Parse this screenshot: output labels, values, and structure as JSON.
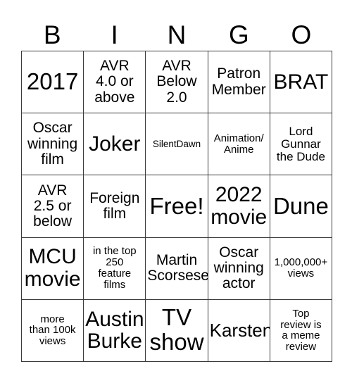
{
  "card": {
    "title": "BINGO",
    "header_letters": [
      "B",
      "I",
      "N",
      "G",
      "O"
    ],
    "grid_size": "5x5",
    "colors": {
      "background": "#ffffff",
      "border": "#3a3a3a",
      "text": "#000000"
    },
    "rows": [
      [
        {
          "text": "2017",
          "size": "xxl"
        },
        {
          "text": "AVR\n4.0 or\nabove",
          "size": "md"
        },
        {
          "text": "AVR\nBelow\n2.0",
          "size": "md"
        },
        {
          "text": "Patron\nMember",
          "size": "md"
        },
        {
          "text": "BRAT",
          "size": "xl"
        }
      ],
      [
        {
          "text": "Oscar\nwinning\nfilm",
          "size": "md"
        },
        {
          "text": "Joker",
          "size": "xl"
        },
        {
          "text": "SilentDawn",
          "size": "xxs"
        },
        {
          "text": "Animation/\nAnime",
          "size": "xs"
        },
        {
          "text": "Lord\nGunnar\nthe Dude",
          "size": "sm"
        }
      ],
      [
        {
          "text": "AVR\n2.5 or\nbelow",
          "size": "md"
        },
        {
          "text": "Foreign\nfilm",
          "size": "md"
        },
        {
          "text": "Free!",
          "size": "xxl"
        },
        {
          "text": "2022\nmovie",
          "size": "xl"
        },
        {
          "text": "Dune",
          "size": "xxl"
        }
      ],
      [
        {
          "text": "MCU\nmovie",
          "size": "xl"
        },
        {
          "text": "in the top\n250\nfeature\nfilms",
          "size": "xs"
        },
        {
          "text": "Martin\nScorsese",
          "size": "md"
        },
        {
          "text": "Oscar\nwinning\nactor",
          "size": "md"
        },
        {
          "text": "1,000,000+\nviews",
          "size": "xs"
        }
      ],
      [
        {
          "text": "more\nthan 100k\nviews",
          "size": "xs"
        },
        {
          "text": "Austin\nBurke",
          "size": "xl"
        },
        {
          "text": "TV\nshow",
          "size": "xxl"
        },
        {
          "text": "Karsten",
          "size": "lg"
        },
        {
          "text": "Top\nreview is\na meme\nreview",
          "size": "xs"
        }
      ]
    ]
  }
}
